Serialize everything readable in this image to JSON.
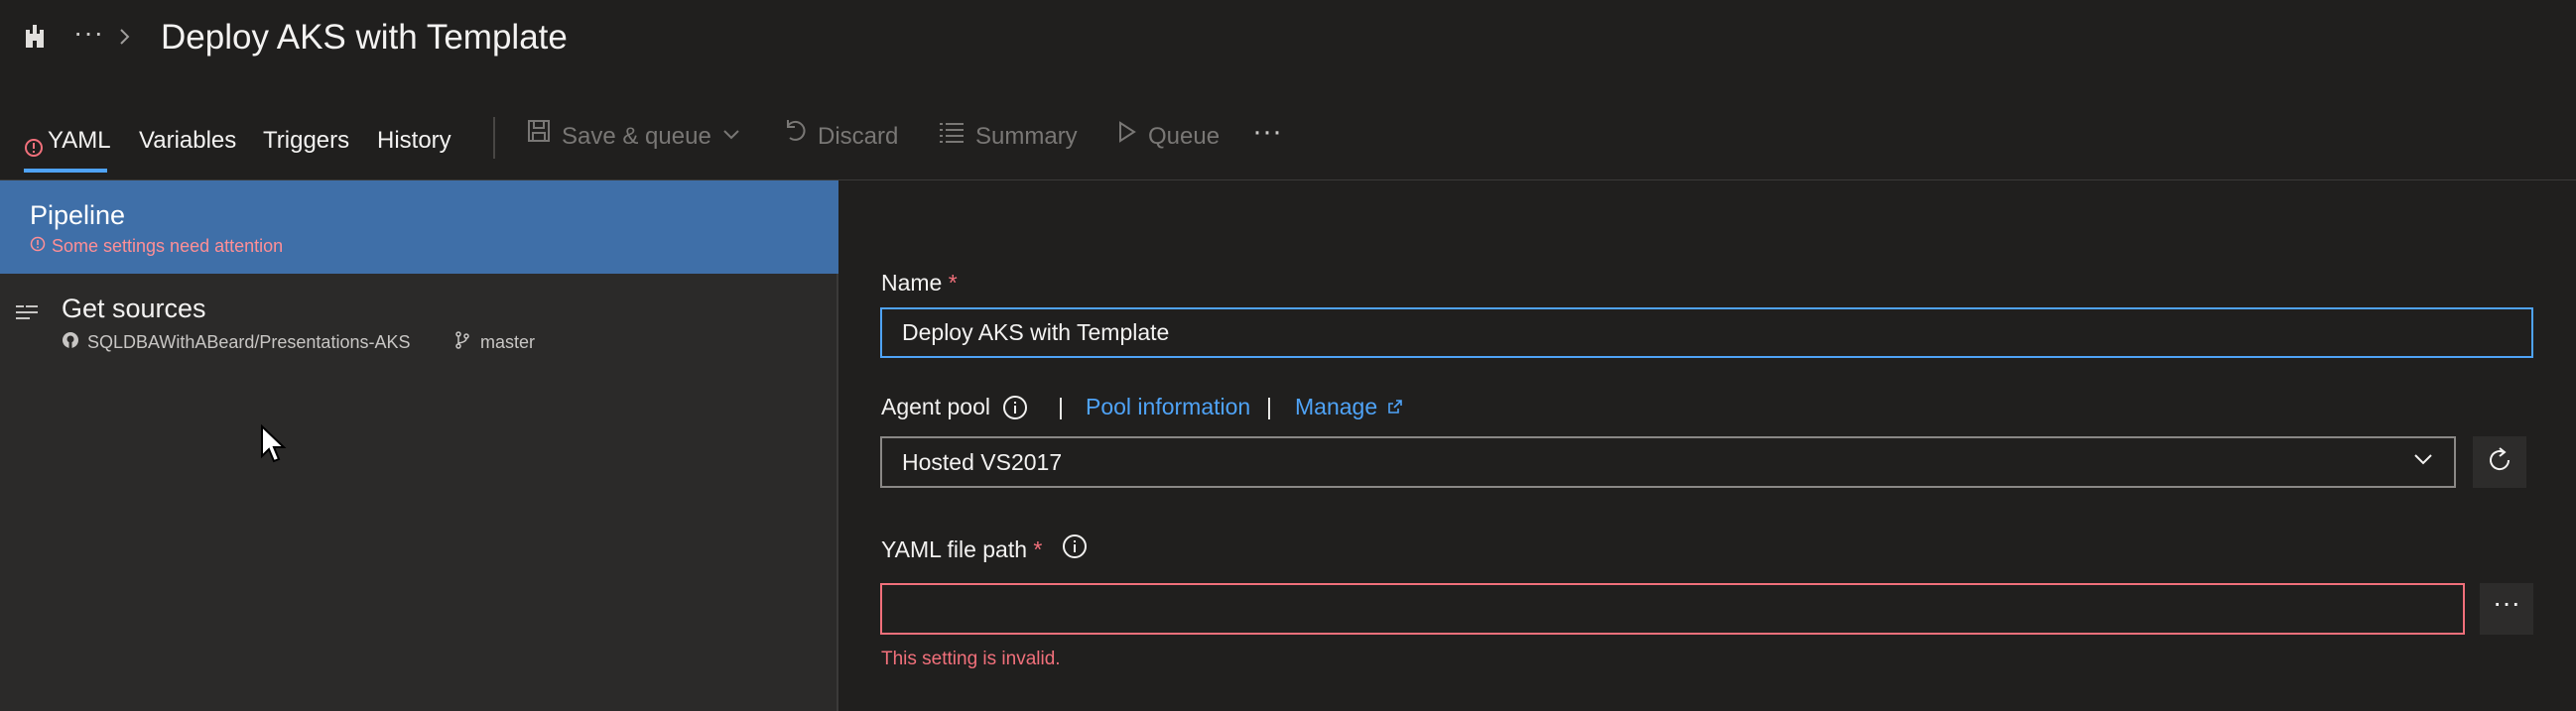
{
  "header": {
    "logo_icon": "pipeline-castle-icon",
    "more_label": "···",
    "title": "Deploy AKS with Template"
  },
  "tabs": [
    {
      "label": "YAML",
      "active": true,
      "warning": true
    },
    {
      "label": "Variables"
    },
    {
      "label": "Triggers"
    },
    {
      "label": "History"
    }
  ],
  "toolbar": {
    "save_queue_label": "Save & queue",
    "discard_label": "Discard",
    "summary_label": "Summary",
    "queue_label": "Queue",
    "more_label": "···"
  },
  "left": {
    "pipeline": {
      "title": "Pipeline",
      "warning": "Some settings need attention"
    },
    "get_sources": {
      "title": "Get sources",
      "repo": "SQLDBAWithABeard/Presentations-AKS",
      "branch": "master"
    }
  },
  "form": {
    "name_label": "Name",
    "required_mark": "*",
    "name_value": "Deploy AKS with Template",
    "agent_pool_label": "Agent pool",
    "separator": "|",
    "pool_info_link": "Pool information",
    "manage_link": "Manage",
    "agent_pool_value": "Hosted VS2017",
    "yaml_label": "YAML file path",
    "yaml_value": "",
    "yaml_more_label": "···",
    "yaml_error": "This setting is invalid."
  },
  "colors": {
    "background": "#201f1e",
    "pane": "#2b2a29",
    "selected": "#3f6fa8",
    "accent": "#4fa3f7",
    "error": "#f1707b",
    "disabled": "#797775"
  }
}
